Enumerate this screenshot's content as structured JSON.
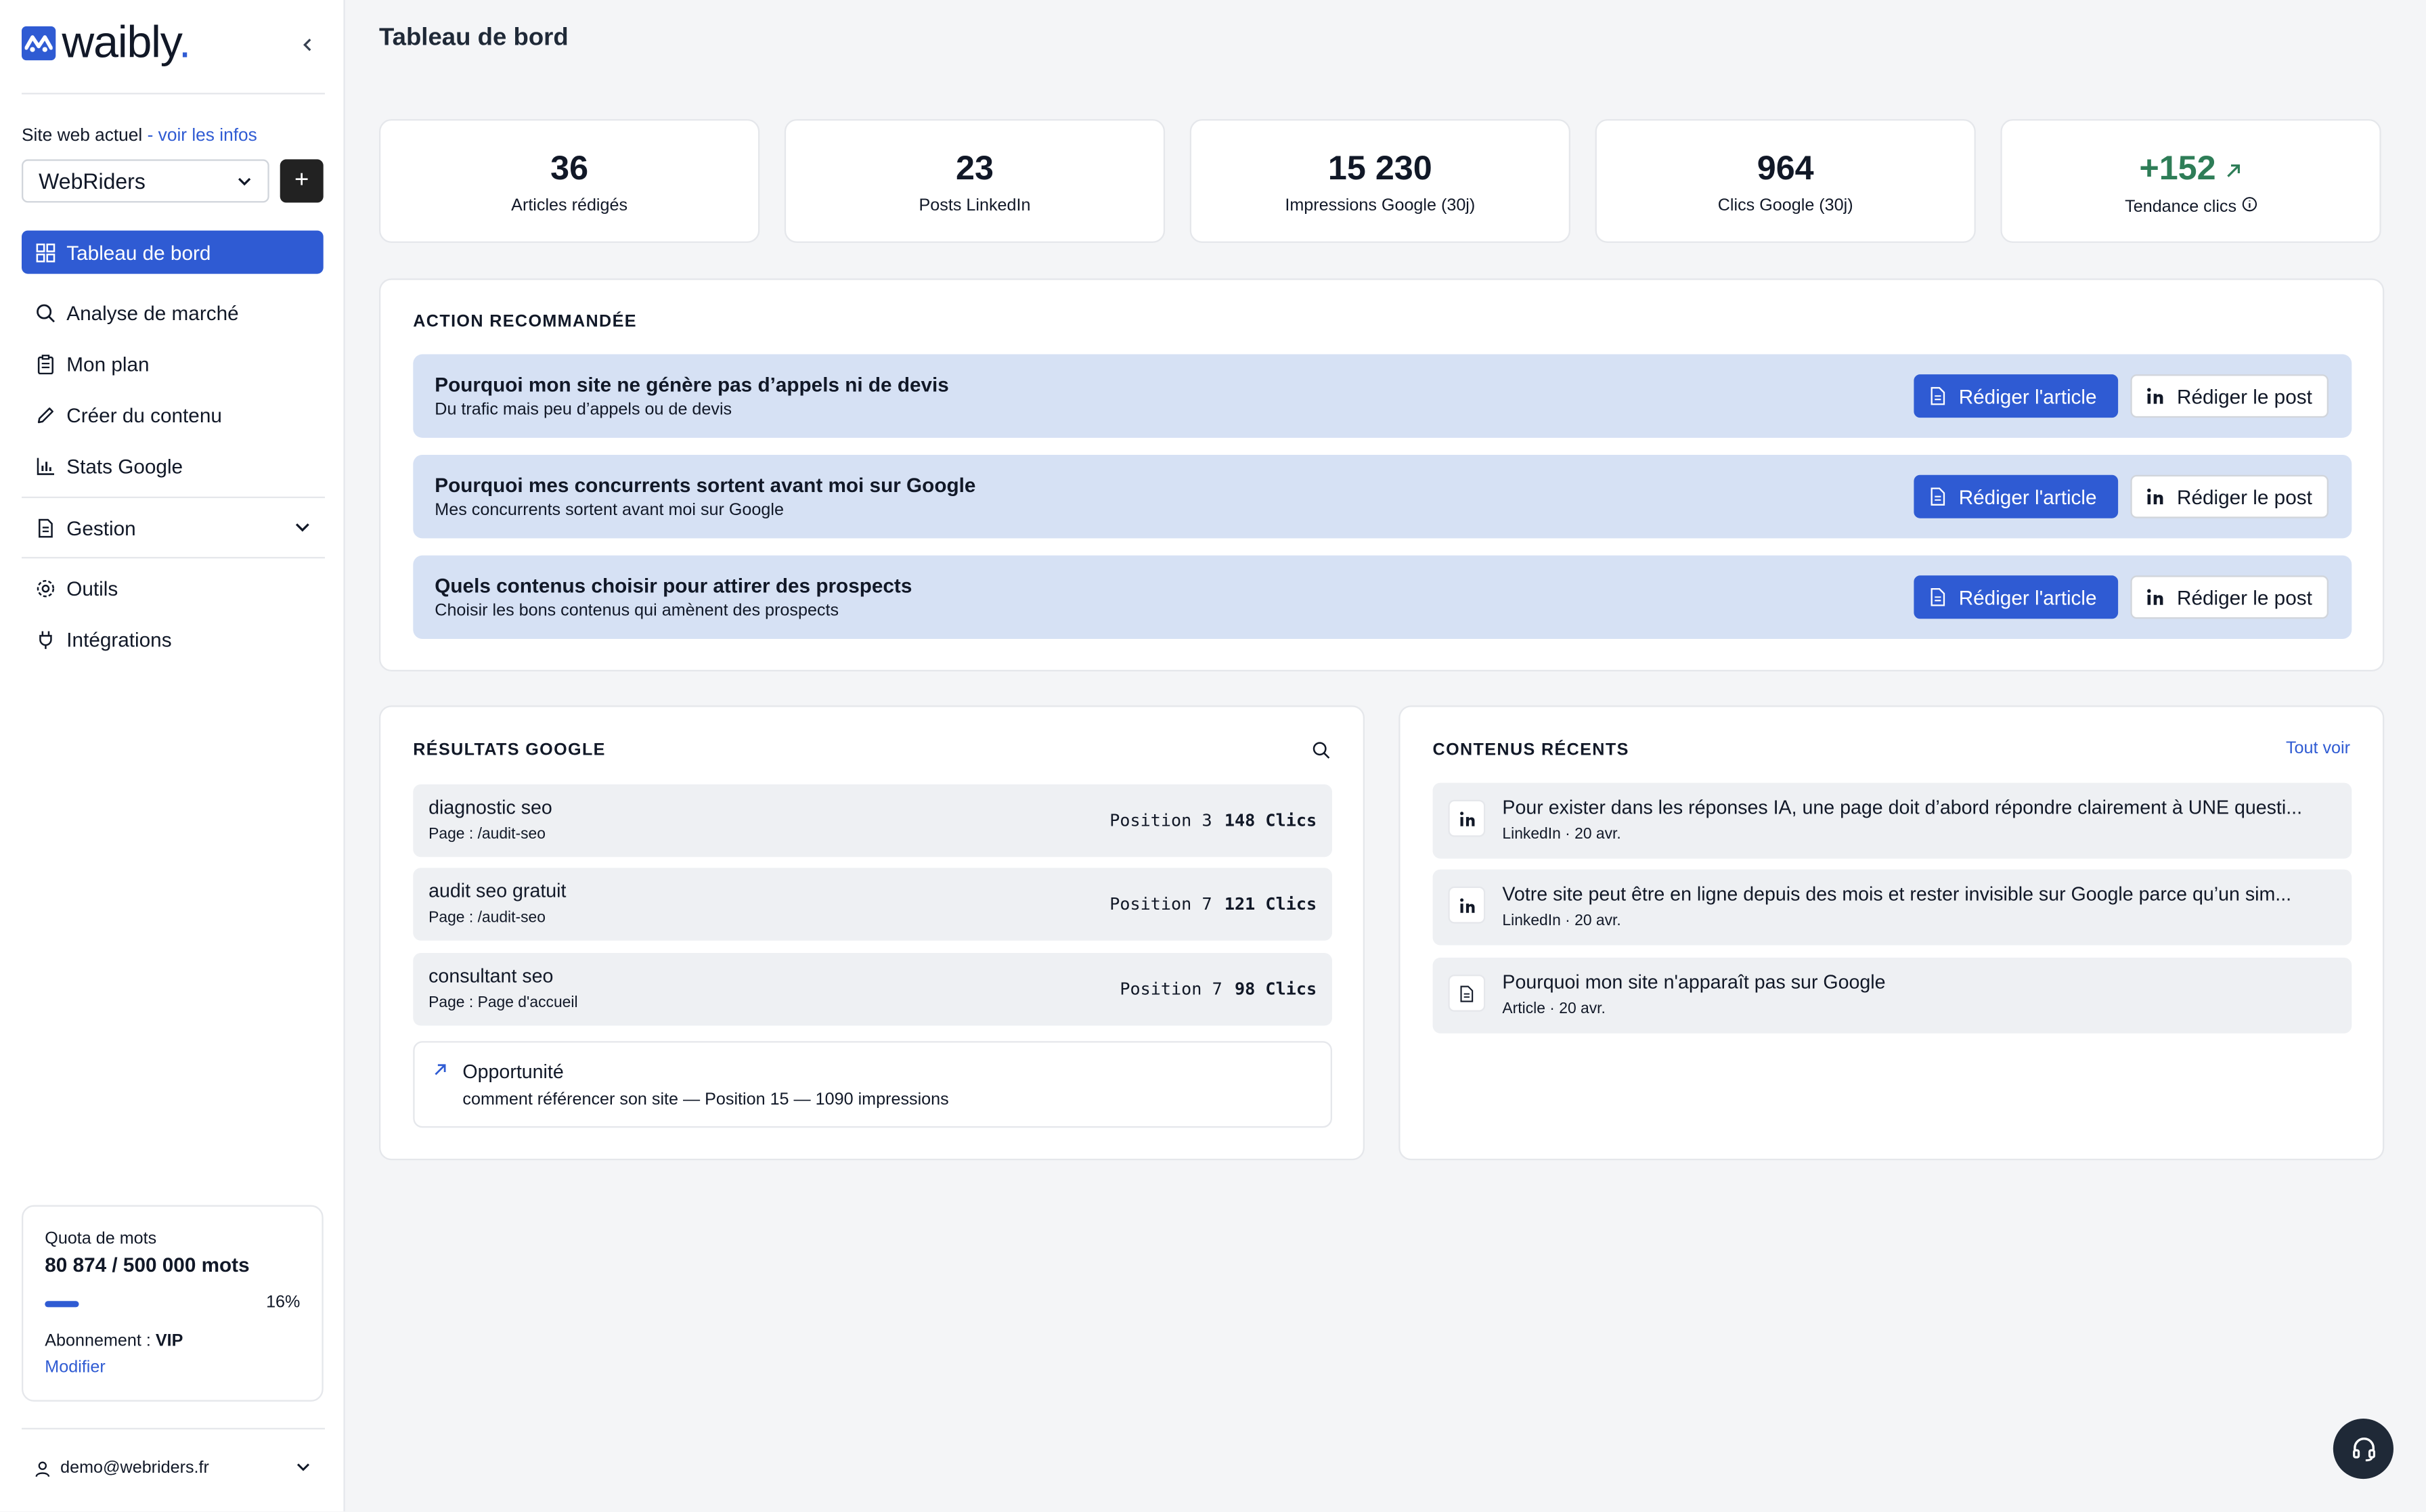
{
  "brand": {
    "logo_text": "waibly",
    "logo_dot": ".",
    "accent": "#2f5bd3"
  },
  "sidebar": {
    "site_label": "Site web actuel",
    "site_link_prefix": " - ",
    "site_link": "voir les infos",
    "site_selected": "WebRiders",
    "add_label": "+",
    "nav": [
      {
        "label": "Tableau de bord",
        "icon": "dashboard-icon",
        "active": true
      },
      {
        "label": "Analyse de marché",
        "icon": "search-icon"
      },
      {
        "label": "Mon plan",
        "icon": "clipboard-icon"
      },
      {
        "label": "Créer du contenu",
        "icon": "pencil-icon"
      },
      {
        "label": "Stats Google",
        "icon": "bar-chart-icon"
      },
      {
        "label": "Gestion",
        "icon": "document-icon"
      },
      {
        "label": "Outils",
        "icon": "gear-icon"
      },
      {
        "label": "Intégrations",
        "icon": "plug-icon"
      }
    ],
    "quota": {
      "title": "Quota de mots",
      "value": "80 874 / 500 000 mots",
      "percent_label": "16%",
      "percent": 16,
      "subscription_label": "Abonnement : ",
      "subscription_value": "VIP",
      "modify_label": "Modifier"
    },
    "user_email": "demo@webriders.fr"
  },
  "header": {
    "title": "Tableau de bord"
  },
  "stats": [
    {
      "value": "36",
      "label": "Articles rédigés"
    },
    {
      "value": "23",
      "label": "Posts LinkedIn"
    },
    {
      "value": "15 230",
      "label": "Impressions Google (30j)"
    },
    {
      "value": "964",
      "label": "Clics Google (30j)"
    },
    {
      "value": "+152",
      "label": "Tendance clics",
      "trend_color": "#2e7d57"
    }
  ],
  "actions": {
    "title": "ACTION RECOMMANDÉE",
    "article_label": "Rédiger l'article",
    "post_label": "Rédiger le post",
    "items": [
      {
        "title": "Pourquoi mon site ne génère pas d’appels ni de devis",
        "subtitle": "Du trafic mais peu d’appels ou de devis"
      },
      {
        "title": "Pourquoi mes concurrents sortent avant moi sur Google",
        "subtitle": "Mes concurrents sortent avant moi sur Google"
      },
      {
        "title": "Quels contenus choisir pour attirer des prospects",
        "subtitle": "Choisir les bons contenus qui amènent des prospects"
      }
    ]
  },
  "google_results": {
    "title": "RÉSULTATS GOOGLE",
    "rows": [
      {
        "query": "diagnostic seo",
        "page": "Page : /audit-seo",
        "position": "Position 3",
        "clicks": "148 Clics"
      },
      {
        "query": "audit seo gratuit",
        "page": "Page : /audit-seo",
        "position": "Position 7",
        "clicks": "121 Clics"
      },
      {
        "query": "consultant seo",
        "page": "Page : Page d'accueil",
        "position": "Position 7",
        "clicks": "98 Clics"
      }
    ],
    "opportunity": {
      "title": "Opportunité",
      "keyword": "comment référencer son site",
      "details": " — Position 15 — 1090 impressions"
    }
  },
  "recent": {
    "title": "CONTENUS RÉCENTS",
    "see_all": "Tout voir",
    "items": [
      {
        "title": "Pour exister dans les réponses IA, une page doit d’abord répondre clairement à UNE questi...",
        "meta": "LinkedIn · 20 avr.",
        "icon": "linkedin-icon"
      },
      {
        "title": "Votre site peut être en ligne depuis des mois et rester invisible sur Google parce qu’un sim...",
        "meta": "LinkedIn · 20 avr.",
        "icon": "linkedin-icon"
      },
      {
        "title": "Pourquoi mon site n'apparaît pas sur Google",
        "meta": "Article · 20 avr.",
        "icon": "document-icon"
      }
    ]
  }
}
